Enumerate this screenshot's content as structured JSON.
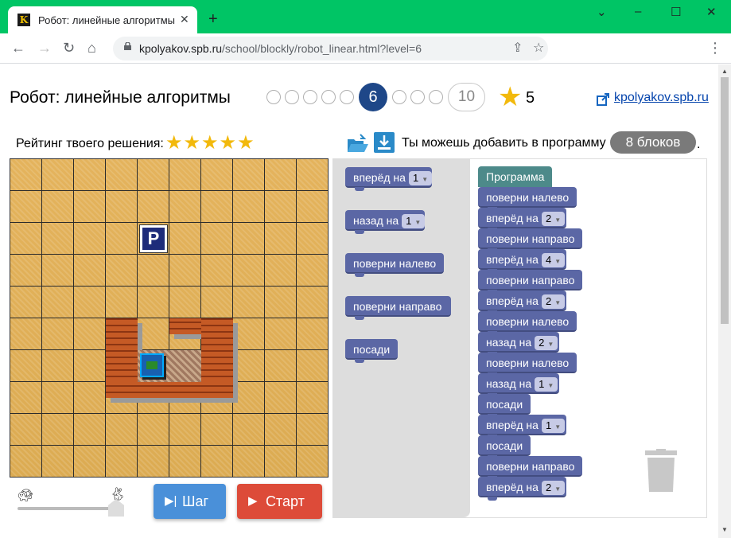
{
  "browser": {
    "tab_title": "Робот: линейные алгоритмы",
    "tab_favicon": "K",
    "url_host": "kpolyakov.spb.ru",
    "url_path": "/school/blockly/robot_linear.html?level=6"
  },
  "header": {
    "title": "Робот: линейные алгоритмы",
    "current_level": "6",
    "last_level": "10",
    "score": "5",
    "site_link": "kpolyakov.spb.ru"
  },
  "rating": {
    "label": "Рейтинг твоего решения:",
    "stars": "★★★★★"
  },
  "program_info": {
    "text": "Ты можешь добавить в программу",
    "badge": "8 блоков",
    "trailing": "."
  },
  "toolbox": [
    {
      "label": "вперёд на",
      "value": "1"
    },
    {
      "label": "назад на",
      "value": "1"
    },
    {
      "label": "поверни налево"
    },
    {
      "label": "поверни направо"
    },
    {
      "label": "посади"
    }
  ],
  "program": {
    "title": "Программа",
    "blocks": [
      {
        "label": "поверни налево"
      },
      {
        "label": "вперёд на",
        "value": "2"
      },
      {
        "label": "поверни направо"
      },
      {
        "label": "вперёд на",
        "value": "4"
      },
      {
        "label": "поверни направо"
      },
      {
        "label": "вперёд на",
        "value": "2"
      },
      {
        "label": "поверни налево"
      },
      {
        "label": "назад на",
        "value": "2"
      },
      {
        "label": "поверни налево"
      },
      {
        "label": "назад на",
        "value": "1"
      },
      {
        "label": "посади"
      },
      {
        "label": "вперёд на",
        "value": "1"
      },
      {
        "label": "посади"
      },
      {
        "label": "поверни направо"
      },
      {
        "label": "вперёд на",
        "value": "2"
      }
    ]
  },
  "controls": {
    "step_label": "Шаг",
    "start_label": "Старт"
  },
  "field": {
    "parking_letter": "P"
  },
  "colors": {
    "browser_frame": "#00c565",
    "level_current": "#1e4788",
    "block": "#5b67a5",
    "hat_block": "#4d8a8a",
    "step_button": "#4a90d9",
    "start_button": "#dd4b39",
    "star": "#f2b90c"
  }
}
